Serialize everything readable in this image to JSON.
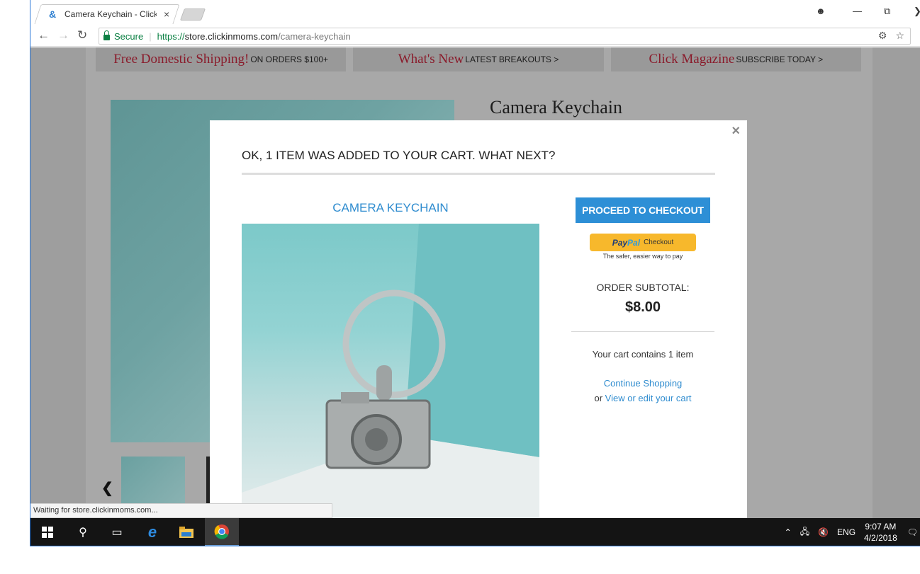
{
  "browser": {
    "tab_title": "Camera Keychain - Click",
    "tab_close": "×",
    "secure_label": "Secure",
    "url_scheme": "https://",
    "url_host": "store.clickinmoms.com",
    "url_path": "/camera-keychain",
    "status_text": "Waiting for store.clickinmoms.com..."
  },
  "promo": [
    {
      "big": "Free Domestic Shipping!",
      "small": "ON ORDERS $100+"
    },
    {
      "big": "What's New",
      "small": "LATEST BREAKOUTS >"
    },
    {
      "big": "Click Magazine",
      "small": "SUBSCRIBE TODAY >"
    }
  ],
  "page": {
    "product_title": "Camera Keychain"
  },
  "modal": {
    "close": "×",
    "heading": "OK, 1 ITEM WAS ADDED TO YOUR CART. WHAT NEXT?",
    "product_name": "CAMERA KEYCHAIN",
    "checkout_label": "PROCEED TO CHECKOUT",
    "paypal_pay": "Pay",
    "paypal_pal": "Pal",
    "paypal_checkout": "Checkout",
    "paypal_tagline": "The safer, easier way to pay",
    "subtotal_label": "ORDER SUBTOTAL:",
    "subtotal_value": "$8.00",
    "cart_count": "Your cart contains 1 item",
    "continue_label": "Continue Shopping",
    "or_label": "or",
    "view_cart_label": "View or edit your cart"
  },
  "taskbar": {
    "lang": "ENG",
    "time": "9:07 AM",
    "date": "4/2/2018"
  },
  "colors": {
    "accent_blue": "#2d8fd6",
    "link_blue": "#2f8ccf",
    "promo_red": "#8a1b2b",
    "paypal_yellow": "#f7b82c"
  }
}
